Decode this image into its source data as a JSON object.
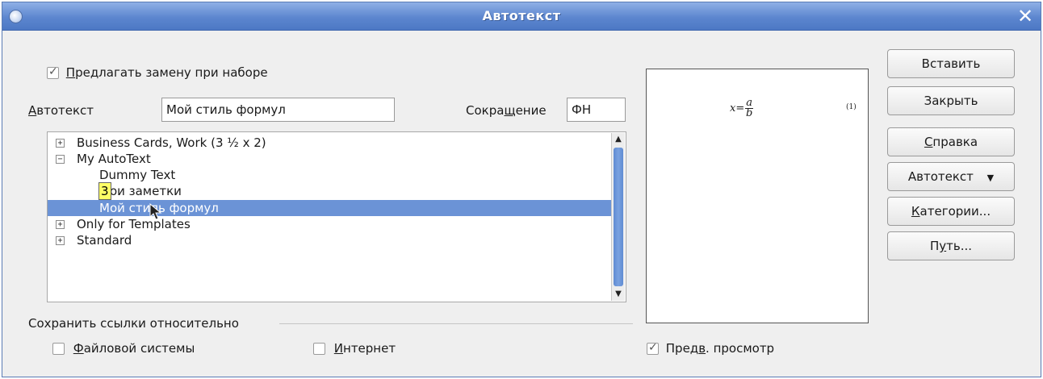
{
  "window": {
    "title": "Автотекст",
    "close_glyph": "✕"
  },
  "options": {
    "suggest_label_u": "П",
    "suggest_label_rest": "редлагать замену при наборе",
    "suggest_checked": true
  },
  "autotext_field": {
    "label_u": "А",
    "label_rest": "втотекст",
    "value": "Мой стиль формул"
  },
  "shortcut_field": {
    "label_pre": "Сокра",
    "label_u": "щ",
    "label_post": "ение",
    "value": "ФН"
  },
  "tree": {
    "items": [
      {
        "label": "Business Cards, Work (3 ½ x 2)",
        "expander": "+"
      },
      {
        "label": "My AutoText",
        "expander": "−"
      },
      {
        "label": "Dummy Text"
      },
      {
        "label": "Мои заметки"
      },
      {
        "label": "Мой стиль формул"
      },
      {
        "label": "Only for Templates",
        "expander": "+"
      },
      {
        "label": "Standard",
        "expander": "+"
      }
    ],
    "tooltip": "3"
  },
  "preview": {
    "formula_var": "x",
    "formula_eq": "=",
    "numerator": "a",
    "denominator": "b",
    "equation_number": "(1)"
  },
  "buttons": {
    "insert": "Вставить",
    "close": "Закрыть",
    "help_u": "С",
    "help_rest": "правка",
    "autotext": "Автотекст",
    "autotext_arrow": "▼",
    "categories_u": "К",
    "categories_rest": "атегории...",
    "path_pre": "П",
    "path_u": "у",
    "path_post": "ть..."
  },
  "save_links": {
    "group_label": "Сохранить ссылки относительно",
    "filesystem_u": "Ф",
    "filesystem_rest": "айловой системы",
    "filesystem_checked": false,
    "internet_u": "И",
    "internet_rest": "нтернет",
    "internet_checked": false
  },
  "preview_toggle": {
    "label_pre": "Пред",
    "label_u": "в",
    "label_post": ". просмотр",
    "checked": true
  }
}
